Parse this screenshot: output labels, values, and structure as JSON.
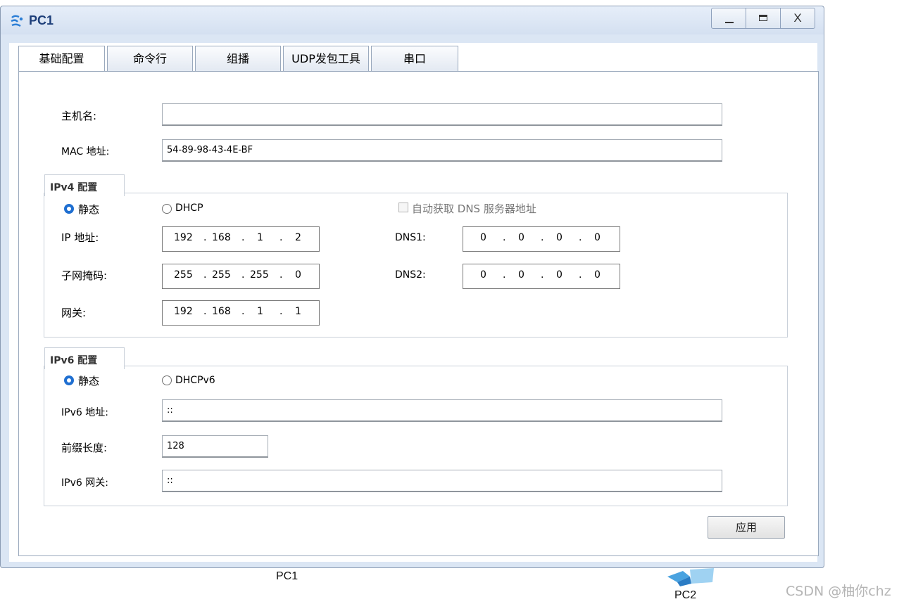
{
  "window": {
    "title": "PC1"
  },
  "tabs": [
    "基础配置",
    "命令行",
    "组播",
    "UDP发包工具",
    "串口"
  ],
  "basic": {
    "hostname_label": "主机名:",
    "hostname_value": "",
    "mac_label": "MAC 地址:",
    "mac_value": "54-89-98-43-4E-BF"
  },
  "ipv4": {
    "title": "IPv4 配置",
    "static_label": "静态",
    "dhcp_label": "DHCP",
    "auto_dns_label": "自动获取 DNS 服务器地址",
    "ip_label": "IP 地址:",
    "ip": [
      "192",
      "168",
      "1",
      "2"
    ],
    "mask_label": "子网掩码:",
    "mask": [
      "255",
      "255",
      "255",
      "0"
    ],
    "gateway_label": "网关:",
    "gateway": [
      "192",
      "168",
      "1",
      "1"
    ],
    "dns1_label": "DNS1:",
    "dns1": [
      "0",
      "0",
      "0",
      "0"
    ],
    "dns2_label": "DNS2:",
    "dns2": [
      "0",
      "0",
      "0",
      "0"
    ]
  },
  "ipv6": {
    "title": "IPv6 配置",
    "static_label": "静态",
    "dhcp_label": "DHCPv6",
    "addr_label": "IPv6 地址:",
    "addr_value": "::",
    "prefix_label": "前缀长度:",
    "prefix_value": "128",
    "gateway_label": "IPv6 网关:",
    "gateway_value": "::"
  },
  "apply_label": "应用",
  "background": {
    "pc1_label": "PC1",
    "pc2_label": "PC2",
    "watermark": "CSDN @柚你chz"
  },
  "colors": {
    "title_text": "#1e3f7a",
    "radio_selected": "#1f6fd1",
    "frame": "#dbe6f4"
  }
}
